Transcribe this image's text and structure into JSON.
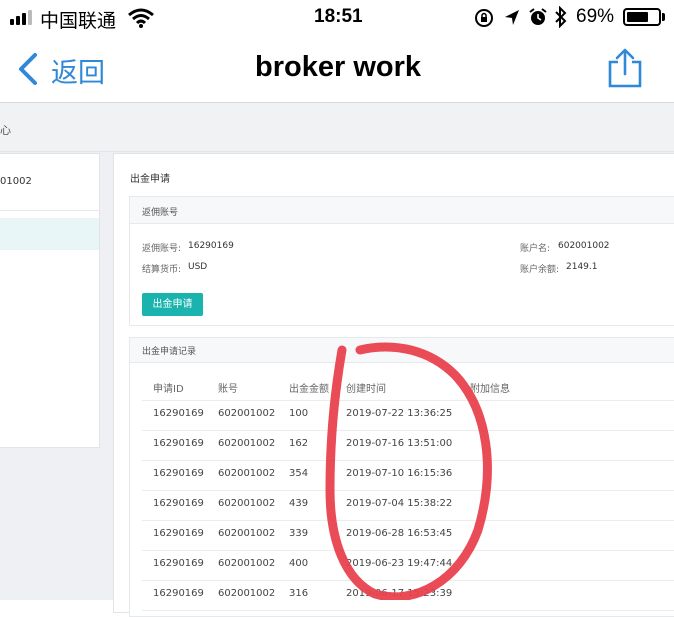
{
  "status_bar": {
    "carrier": "中国联通",
    "time": "18:51",
    "battery": "69%",
    "battery_level": 0.69
  },
  "nav": {
    "back_label": "返回",
    "title": "broker work"
  },
  "breadcrumb": {
    "text": "心"
  },
  "left_panel": {
    "account_fragment": "01002"
  },
  "main": {
    "page_title": "出金申请",
    "rebate": {
      "title": "返佣账号",
      "account_label": "返佣账号:",
      "account_value": "16290169",
      "currency_label": "结算货币:",
      "currency_value": "USD",
      "name_label": "账户名:",
      "name_value": "602001002",
      "balance_label": "账户余额:",
      "balance_value": "2149.1",
      "button": "出金申请"
    },
    "records": {
      "title": "出金申请记录",
      "headers": [
        "申请ID",
        "账号",
        "出金金额",
        "创建时间",
        "附加信息"
      ],
      "rows": [
        [
          "16290169",
          "602001002",
          "100",
          "2019-07-22 13:36:25",
          ""
        ],
        [
          "16290169",
          "602001002",
          "162",
          "2019-07-16 13:51:00",
          ""
        ],
        [
          "16290169",
          "602001002",
          "354",
          "2019-07-10 16:15:36",
          ""
        ],
        [
          "16290169",
          "602001002",
          "439",
          "2019-07-04 15:38:22",
          ""
        ],
        [
          "16290169",
          "602001002",
          "339",
          "2019-06-28 16:53:45",
          ""
        ],
        [
          "16290169",
          "602001002",
          "400",
          "2019-06-23 19:47:44",
          ""
        ],
        [
          "16290169",
          "602001002",
          "316",
          "2019-06-17 15:23:39",
          ""
        ]
      ]
    }
  },
  "colors": {
    "accent": "#2f88d8",
    "button": "#1ab3ad",
    "annotation": "#e8424e"
  }
}
